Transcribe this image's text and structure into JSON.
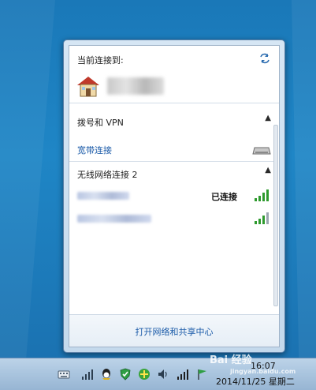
{
  "popup": {
    "current_label": "当前连接到:",
    "dialup_section": "拨号和 VPN",
    "broadband_link": "宽带连接",
    "wireless_section": "无线网络连接 2",
    "wifi_status": "已连接",
    "footer_link": "打开网络和共享中心",
    "chevron": "▲"
  },
  "taskbar": {
    "date": "2014/11/25 星期二",
    "time": "16:07"
  },
  "icons": [
    "refresh-icon",
    "house-icon",
    "modem-icon",
    "signal-bars-icon",
    "keyboard-icon",
    "network-icon",
    "qq-icon",
    "shield-icon",
    "plus-icon",
    "volume-icon",
    "flag-icon"
  ]
}
